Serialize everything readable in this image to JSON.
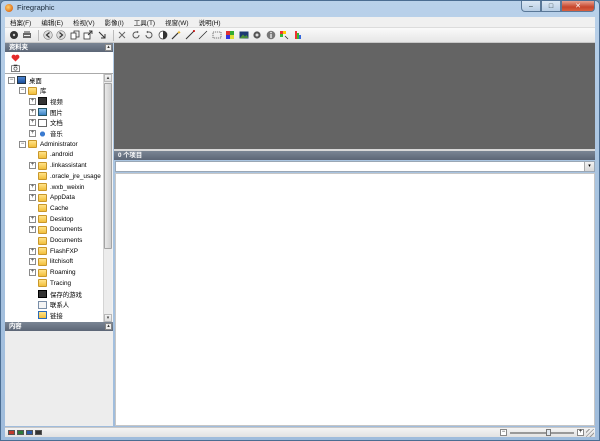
{
  "window": {
    "title": "Firegraphic",
    "minimize": "–",
    "maximize": "□",
    "close": "✕"
  },
  "menu": [
    "档案(F)",
    "编辑(E)",
    "检视(V)",
    "影像(I)",
    "工具(T)",
    "视窗(W)",
    "说明(H)"
  ],
  "toolbar_icons": [
    "disc-icon",
    "scanner-icon",
    "back-arrow-icon",
    "forward-arrow-icon",
    "copy-icon",
    "export-icon",
    "move-icon",
    "cut-icon",
    "rotate-left-icon",
    "rotate-right-icon",
    "contrast-icon",
    "magic-wand-icon",
    "line-tool-icon",
    "pen-icon",
    "select-rect-icon",
    "color-grid-icon",
    "landscape-icon",
    "settings-gear-icon",
    "info-icon",
    "palette-icon",
    "color-bars-icon"
  ],
  "favorites": {
    "header": "资料夹",
    "collapse": "▴"
  },
  "tree": [
    {
      "label": "",
      "icon": "heart-icon",
      "level": 1,
      "exp": ""
    },
    {
      "label": "",
      "icon": "camera-icon",
      "level": 1,
      "exp": ""
    },
    {
      "label": "桌面",
      "icon": "desktop-icon",
      "level": 0,
      "exp": "−"
    },
    {
      "label": "库",
      "icon": "library-folder-icon",
      "level": 1,
      "exp": "−"
    },
    {
      "label": "视频",
      "icon": "video-icon",
      "level": 2,
      "exp": "+"
    },
    {
      "label": "图片",
      "icon": "pictures-icon",
      "level": 2,
      "exp": "+"
    },
    {
      "label": "文档",
      "icon": "documents-icon",
      "level": 2,
      "exp": "+"
    },
    {
      "label": "音乐",
      "icon": "music-icon",
      "level": 2,
      "exp": "+"
    },
    {
      "label": "Administrator",
      "icon": "user-folder-icon",
      "level": 1,
      "exp": "−"
    },
    {
      "label": ".android",
      "icon": "folder-icon",
      "level": 2,
      "exp": ""
    },
    {
      "label": ".linkassistant",
      "icon": "folder-icon",
      "level": 2,
      "exp": "+"
    },
    {
      "label": ".oracle_jre_usage",
      "icon": "folder-icon",
      "level": 2,
      "exp": ""
    },
    {
      "label": ".wxb_weixin",
      "icon": "folder-icon",
      "level": 2,
      "exp": "+"
    },
    {
      "label": "AppData",
      "icon": "folder-icon",
      "level": 2,
      "exp": "+"
    },
    {
      "label": "Cache",
      "icon": "folder-icon",
      "level": 2,
      "exp": ""
    },
    {
      "label": "Desktop",
      "icon": "folder-icon",
      "level": 2,
      "exp": "+"
    },
    {
      "label": "Documents",
      "icon": "folder-icon",
      "level": 2,
      "exp": "+"
    },
    {
      "label": "Documents",
      "icon": "folder-icon",
      "level": 2,
      "exp": ""
    },
    {
      "label": "FlashFXP",
      "icon": "folder-icon",
      "level": 2,
      "exp": "+"
    },
    {
      "label": "litchisoft",
      "icon": "folder-icon",
      "level": 2,
      "exp": "+"
    },
    {
      "label": "Roaming",
      "icon": "folder-icon",
      "level": 2,
      "exp": "+"
    },
    {
      "label": "Tracing",
      "icon": "folder-icon",
      "level": 2,
      "exp": ""
    },
    {
      "label": "保存的游戏",
      "icon": "saved-games-icon",
      "level": 2,
      "exp": ""
    },
    {
      "label": "联系人",
      "icon": "contacts-icon",
      "level": 2,
      "exp": ""
    },
    {
      "label": "链接",
      "icon": "links-icon",
      "level": 2,
      "exp": ""
    }
  ],
  "content_panel": {
    "header": "内容",
    "collapse": "▴"
  },
  "list": {
    "header": "0 个项目",
    "combo_value": "",
    "dropdown": "▾"
  },
  "status": {
    "swatches": [
      "#c0392b",
      "#2c7a3a",
      "#2b5aa8",
      "#333333"
    ],
    "zoom_minus": "−",
    "zoom_plus": "+"
  },
  "colors": {
    "preview_bg": "#646464",
    "panel_header": "#5c6676",
    "frame": "#a9c4e0"
  }
}
